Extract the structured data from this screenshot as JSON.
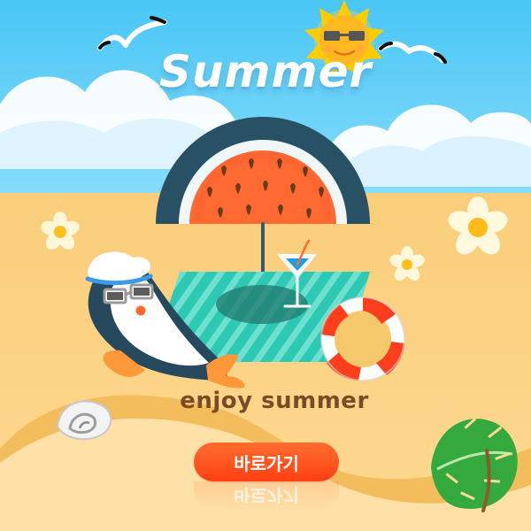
{
  "banner": {
    "title": "Summer",
    "subtitle": "enjoy summer",
    "button_label": "바로가기"
  },
  "colors": {
    "sky": "#4fc3f7",
    "sand": "#f8c96e",
    "button": "#ff4f19"
  },
  "icons": [
    "seagull-icon",
    "sun-icon",
    "watermelon-umbrella-icon",
    "beach-towel-icon",
    "cocktail-icon",
    "penguin-icon",
    "lifebuoy-icon",
    "seashell-icon",
    "palm-leaf-icon",
    "flower-icon"
  ]
}
